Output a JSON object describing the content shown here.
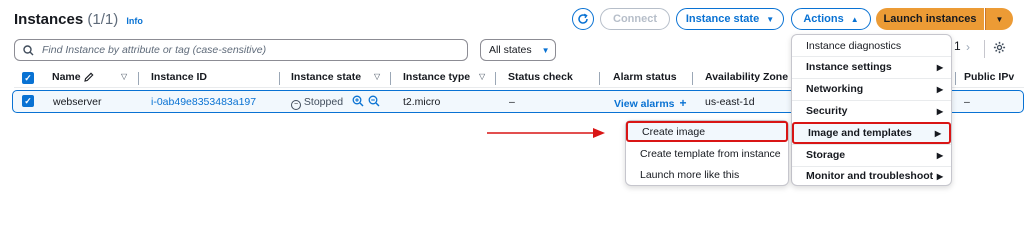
{
  "header": {
    "title": "Instances",
    "count": "(1/1)",
    "info": "Info"
  },
  "toolbar": {
    "connect": "Connect",
    "instance_state": "Instance state",
    "actions": "Actions",
    "launch": "Launch instances"
  },
  "filter": {
    "placeholder": "Find Instance by attribute or tag (case-sensitive)",
    "states": "All states"
  },
  "pager": {
    "page": "1"
  },
  "table": {
    "columns": [
      "Name",
      "Instance ID",
      "Instance state",
      "Instance type",
      "Status check",
      "Alarm status",
      "Availability Zone",
      "Public IPv"
    ],
    "row": {
      "name": "webserver",
      "instance_id": "i-0ab49e8353483a197",
      "state": "Stopped",
      "type": "t2.micro",
      "status_check": "–",
      "alarm": "View alarms",
      "alarm_plus": "+",
      "zone": "us-east-1d",
      "public_ip": "–"
    }
  },
  "actions_menu": {
    "items": [
      {
        "label": "Instance diagnostics",
        "group": false
      },
      {
        "label": "Instance settings",
        "group": true
      },
      {
        "label": "Networking",
        "group": true
      },
      {
        "label": "Security",
        "group": true
      },
      {
        "label": "Image and templates",
        "group": true
      },
      {
        "label": "Storage",
        "group": true
      },
      {
        "label": "Monitor and troubleshoot",
        "group": true
      }
    ]
  },
  "image_submenu": {
    "items": [
      "Create image",
      "Create template from instance",
      "Launch more like this"
    ]
  },
  "colors": {
    "link": "#0972d3",
    "primary": "#ec9b35",
    "highlight": "#d91515"
  }
}
